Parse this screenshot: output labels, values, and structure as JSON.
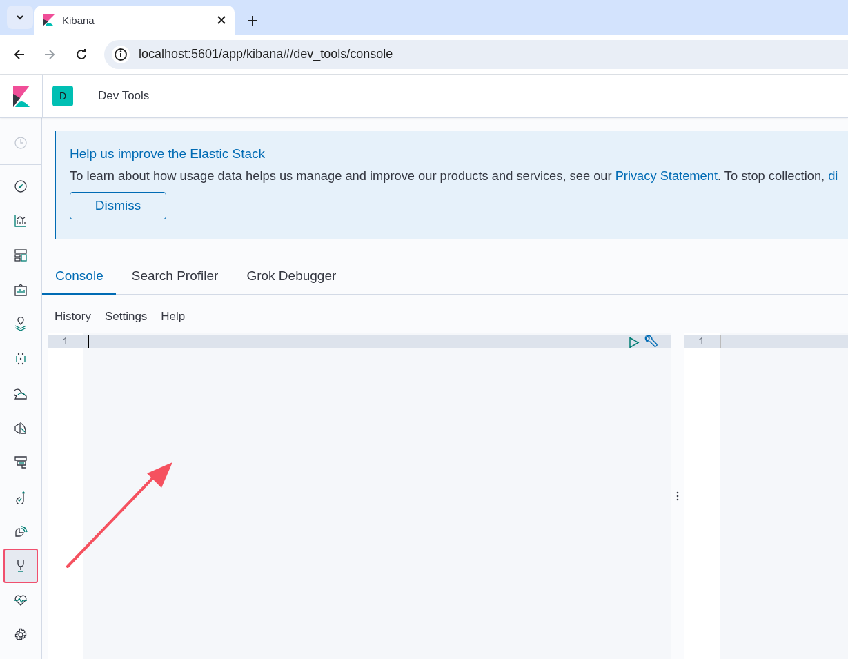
{
  "browser": {
    "tab_title": "Kibana",
    "url": "localhost:5601/app/kibana#/dev_tools/console"
  },
  "header": {
    "space_initial": "D",
    "title": "Dev Tools"
  },
  "sidebar": {
    "items": [
      {
        "kind": "clock",
        "selected": false,
        "disabled": true,
        "annotated": false
      },
      {
        "kind": "compass",
        "selected": false,
        "disabled": false,
        "annotated": false
      },
      {
        "kind": "chart",
        "selected": false,
        "disabled": false,
        "annotated": false
      },
      {
        "kind": "layout",
        "selected": false,
        "disabled": false,
        "annotated": false
      },
      {
        "kind": "frame",
        "selected": false,
        "disabled": false,
        "annotated": false
      },
      {
        "kind": "map",
        "selected": false,
        "disabled": false,
        "annotated": false
      },
      {
        "kind": "dots",
        "selected": false,
        "disabled": false,
        "annotated": false
      },
      {
        "kind": "person",
        "selected": false,
        "disabled": false,
        "annotated": false
      },
      {
        "kind": "shapes",
        "selected": false,
        "disabled": false,
        "annotated": false
      },
      {
        "kind": "server",
        "selected": false,
        "disabled": false,
        "annotated": false
      },
      {
        "kind": "uptime",
        "selected": false,
        "disabled": false,
        "annotated": false
      },
      {
        "kind": "signal",
        "selected": false,
        "disabled": false,
        "annotated": false
      },
      {
        "kind": "wrench",
        "selected": true,
        "disabled": false,
        "annotated": true
      },
      {
        "kind": "heart",
        "selected": false,
        "disabled": false,
        "annotated": false
      },
      {
        "kind": "gear",
        "selected": false,
        "disabled": false,
        "annotated": false
      }
    ]
  },
  "banner": {
    "title": "Help us improve the Elastic Stack",
    "message": [
      {
        "kind": "text",
        "text": "To learn about how usage data helps us manage and improve our products and services, see our "
      },
      {
        "kind": "link",
        "text": "Privacy Statement"
      },
      {
        "kind": "text",
        "text": ". To stop collection, "
      },
      {
        "kind": "link",
        "text": "di"
      }
    ],
    "button": "Dismiss"
  },
  "tabs": [
    {
      "label": "Console",
      "selected": true
    },
    {
      "label": "Search Profiler",
      "selected": false
    },
    {
      "label": "Grok Debugger",
      "selected": false
    }
  ],
  "menu": [
    "History",
    "Settings",
    "Help"
  ],
  "editor": {
    "input_lines": [
      "1"
    ],
    "output_lines": [
      "1"
    ]
  },
  "overlay": {
    "arrow": true
  }
}
